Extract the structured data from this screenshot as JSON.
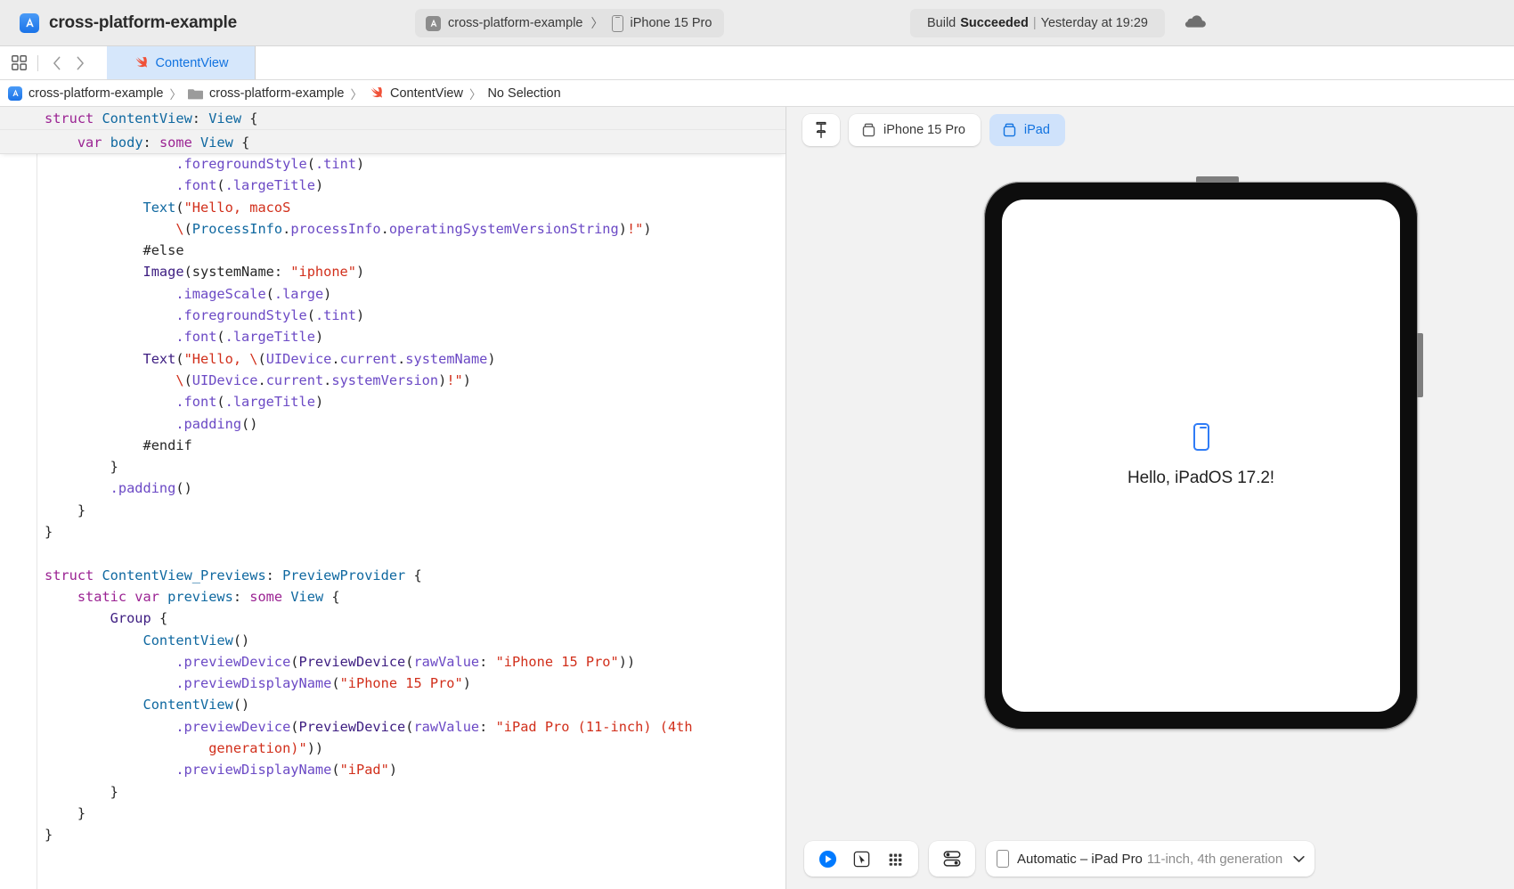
{
  "titlebar": {
    "app_icon": "xcode-app-icon",
    "project_title": "cross-platform-example",
    "scheme": {
      "icon": "scheme-app-icon",
      "label": "cross-platform-example",
      "separator": "〉",
      "destination_icon": "iphone-icon",
      "destination": "iPhone 15 Pro"
    },
    "status": {
      "prefix": "Build",
      "result": "Succeeded",
      "divider": "|",
      "timestamp": "Yesterday at 19:29"
    },
    "cloud_icon": "cloud-icon"
  },
  "tabbar": {
    "grid_icon": "panel-grid-icon",
    "back_icon": "chevron-left-icon",
    "forward_icon": "chevron-right-icon",
    "tabs": [
      {
        "icon": "swift-file-icon",
        "label": "ContentView",
        "selected": true
      }
    ]
  },
  "breadcrumb": {
    "separator": "〉",
    "items": [
      {
        "icon": "xcode-project-icon",
        "label": "cross-platform-example"
      },
      {
        "icon": "folder-icon",
        "label": "cross-platform-example"
      },
      {
        "icon": "swift-file-icon",
        "label": "ContentView"
      },
      {
        "icon": "",
        "label": "No Selection"
      }
    ]
  },
  "editor": {
    "sticky_lines": [
      "struct ContentView: View {",
      "    var body: some View {"
    ],
    "code_lines": [
      "                .foregroundStyle(.tint)",
      "                .font(.largeTitle)",
      "            Text(\"Hello, macoS",
      "                \\(ProcessInfo.processInfo.operatingSystemVersionString)!\")",
      "            #else",
      "            Image(systemName: \"iphone\")",
      "                .imageScale(.large)",
      "                .foregroundStyle(.tint)",
      "                .font(.largeTitle)",
      "            Text(\"Hello, \\(UIDevice.current.systemName)",
      "                \\(UIDevice.current.systemVersion)!\")",
      "                .font(.largeTitle)",
      "                .padding()",
      "            #endif",
      "        }",
      "        .padding()",
      "    }",
      "}",
      "",
      "struct ContentView_Previews: PreviewProvider {",
      "    static var previews: some View {",
      "        Group {",
      "            ContentView()",
      "                .previewDevice(PreviewDevice(rawValue: \"iPhone 15 Pro\"))",
      "                .previewDisplayName(\"iPhone 15 Pro\")",
      "            ContentView()",
      "                .previewDevice(PreviewDevice(rawValue: \"iPad Pro (11-inch) (4th",
      "                    generation)\"))",
      "                .previewDisplayName(\"iPad\")",
      "        }",
      "    }",
      "}"
    ]
  },
  "preview": {
    "pin_icon": "pin-icon",
    "tabs": [
      {
        "icon": "device-icon",
        "label": "iPhone 15 Pro",
        "selected": false
      },
      {
        "icon": "device-icon",
        "label": "iPad",
        "selected": true
      }
    ],
    "device": {
      "symbol_icon": "iphone-symbol",
      "greeting": "Hello, iPadOS 17.2!"
    },
    "controls": {
      "play_icon": "play-circle-icon",
      "select_icon": "pointer-select-icon",
      "variants_icon": "grid-variants-icon",
      "device_settings_icon": "device-settings-icon",
      "destination": {
        "icon": "ipad-icon",
        "primary": "Automatic – iPad Pro",
        "secondary": "11-inch, 4th generation",
        "chevron_icon": "chevron-down-icon"
      }
    }
  },
  "colors": {
    "accent_blue": "#1273e0",
    "tab_selected_bg": "#d6e7fb",
    "preview_tab_selected_bg": "#cfe2fb",
    "canvas_bg": "#f2f2f2",
    "keyword": "#9b2393",
    "type": "#0f68a0",
    "member": "#6b49c5",
    "string": "#d12f1b",
    "play_blue": "#007aff"
  }
}
